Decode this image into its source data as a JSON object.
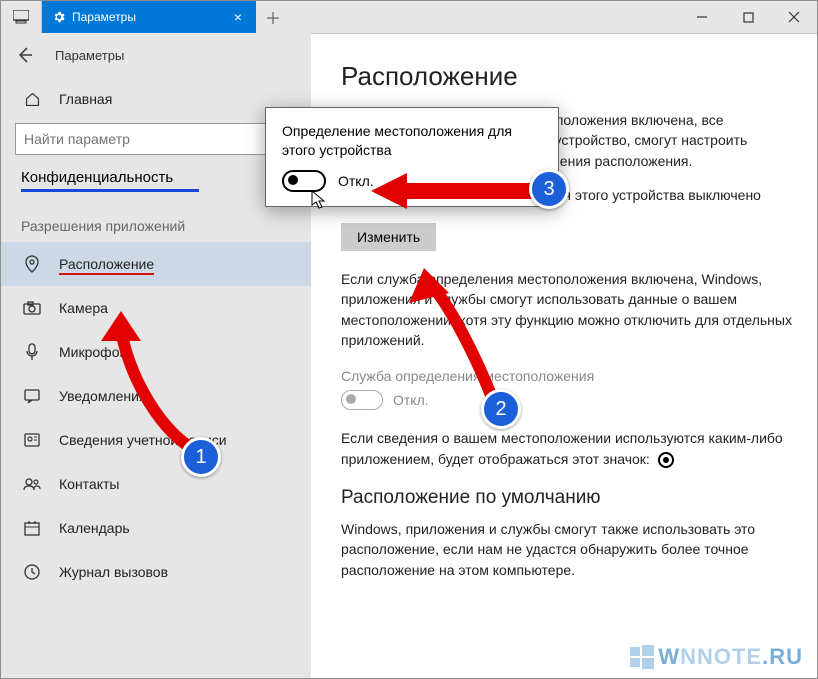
{
  "titlebar": {
    "tab_label": "Параметры"
  },
  "sidebar": {
    "back_title": "Параметры",
    "home": "Главная",
    "search_placeholder": "Найти параметр",
    "privacy": "Конфиденциальность",
    "section": "Разрешения приложений",
    "items": {
      "location": "Расположение",
      "camera": "Камера",
      "microphone": "Микрофон",
      "notifications": "Уведомления",
      "account": "Сведения учетной записи",
      "contacts": "Контакты",
      "calendar": "Календарь",
      "callhistory": "Журнал вызовов"
    }
  },
  "content": {
    "h1": "Расположение",
    "p1": "Если служба определения местоположения включена, все пользователи, вошедшие на это устройство, смогут настроить собственные параметры определения расположения.",
    "p_status": "Определение местоположения для этого устройства выключено",
    "btn_change": "Изменить",
    "p2": "Если служба определения местоположения включена, Windows, приложения и службы смогут использовать данные о вашем местоположении, хотя эту функцию можно отключить для отдельных приложений.",
    "svc_label": "Служба определения местоположения",
    "svc_state": "Откл.",
    "p3_a": "Если сведения о вашем местоположении используются каким-либо приложением, будет отображаться этот значок: ",
    "h2": "Расположение по умолчанию",
    "p4": "Windows, приложения и службы смогут также использовать это расположение, если нам не удастся обнаружить более точное расположение на этом компьютере."
  },
  "popup": {
    "text": "Определение местоположения для этого устройства",
    "state": "Откл."
  },
  "badges": {
    "b1": "1",
    "b2": "2",
    "b3": "3"
  },
  "watermark": {
    "a": "W",
    "b": "NNOTE",
    "c": ".RU"
  }
}
